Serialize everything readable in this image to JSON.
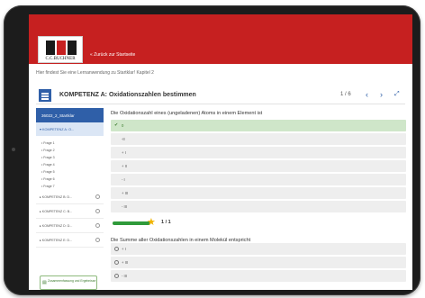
{
  "header": {
    "logo_text": "C.C.BUCHNER",
    "back_link": "« Zurück zur Startseite",
    "subheading": "Hier findest Sie eine Lernanwendung zu Startklar! Kapitel 2"
  },
  "panel": {
    "title": "KOMPETENZ A: Oxidationszahlen bestimmen",
    "counter": "1 / 6",
    "prev_icon": "‹",
    "next_icon": "›",
    "expand_icon": "⤢"
  },
  "sidebar": {
    "top_label": "36022_2_Startklar",
    "selected_item": "▾ KOMPETENZ A: O...",
    "pages": [
      "• Frage 1",
      "• Frage 2",
      "• Frage 3",
      "• Frage 4",
      "• Frage 5",
      "• Frage 6",
      "• Frage 7"
    ],
    "items": [
      "▸ KOMPETENZ B: D...",
      "▸ KOMPETENZ C: B...",
      "▸ KOMPETENZ D: D...",
      "▸ KOMPETENZ E: D..."
    ],
    "summary": "Zusammenfassung und Ergebnisse"
  },
  "question1": {
    "text": "Die Oxidationszahl eines (ungeladenen) Atoms in einem Element ist",
    "options": [
      "0",
      "-II",
      "+ I",
      "+ II",
      "- I",
      "+ III",
      "- III"
    ],
    "correct_index": 0
  },
  "progress": {
    "value": 1.0,
    "label": "1 / 1"
  },
  "question2": {
    "text": "Die Summe aller Oxidationszahlen in einem Molekül entspricht",
    "options": [
      "+ I",
      "+ III",
      "- III"
    ]
  },
  "colors": {
    "brand_red": "#c62020",
    "accent_blue": "#2f5fa8",
    "correct_green": "#cfe6c9",
    "star": "#f0b400"
  }
}
